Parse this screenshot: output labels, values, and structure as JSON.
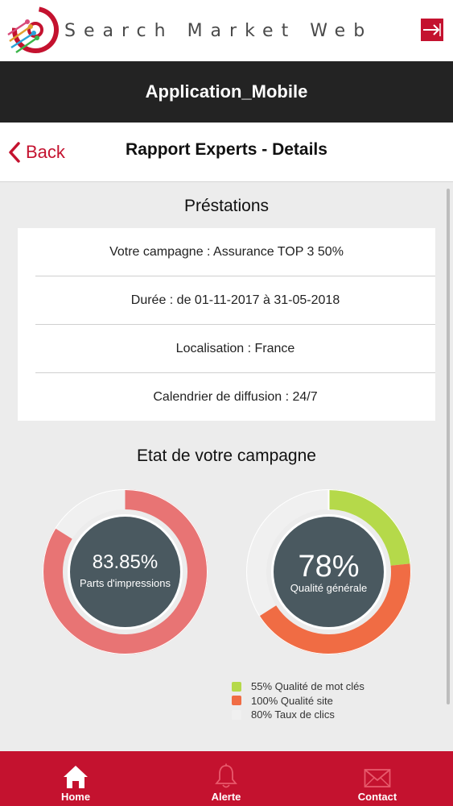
{
  "brand": {
    "name": "Search Market Web"
  },
  "header": {
    "title": "Application_Mobile"
  },
  "nav": {
    "back_label": "Back",
    "title": "Rapport Experts - Details"
  },
  "prestations": {
    "title": "Préstations",
    "rows": [
      "Votre campagne : Assurance TOP 3 50%",
      "Durée : de 01-11-2017 à 31-05-2018",
      "Localisation : France",
      "Calendrier de diffusion : 24/7"
    ]
  },
  "campaign": {
    "title": "Etat de votre campagne",
    "impressions": {
      "value_label": "83.85%",
      "caption": "Parts d'impressions",
      "fraction": 0.8385
    },
    "quality": {
      "value_label": "78%",
      "caption": "Qualité générale"
    },
    "legend": [
      {
        "label": "55% Qualité de mot clés",
        "color": "#b5d94a"
      },
      {
        "label": "100% Qualité site",
        "color": "#f06c44"
      },
      {
        "label": "80% Taux de clics",
        "color": "#f0f0f0"
      }
    ]
  },
  "colors": {
    "accent": "#c4122f",
    "impressions_ring": "#e87474",
    "ring_empty": "#f0f0f0",
    "center": "#4a5960",
    "quality_green": "#b5d94a",
    "quality_orange": "#f06c44"
  },
  "tabs": [
    {
      "label": "Home",
      "icon": "home-icon"
    },
    {
      "label": "Alerte",
      "icon": "bell-icon"
    },
    {
      "label": "Contact",
      "icon": "mail-icon"
    }
  ]
}
